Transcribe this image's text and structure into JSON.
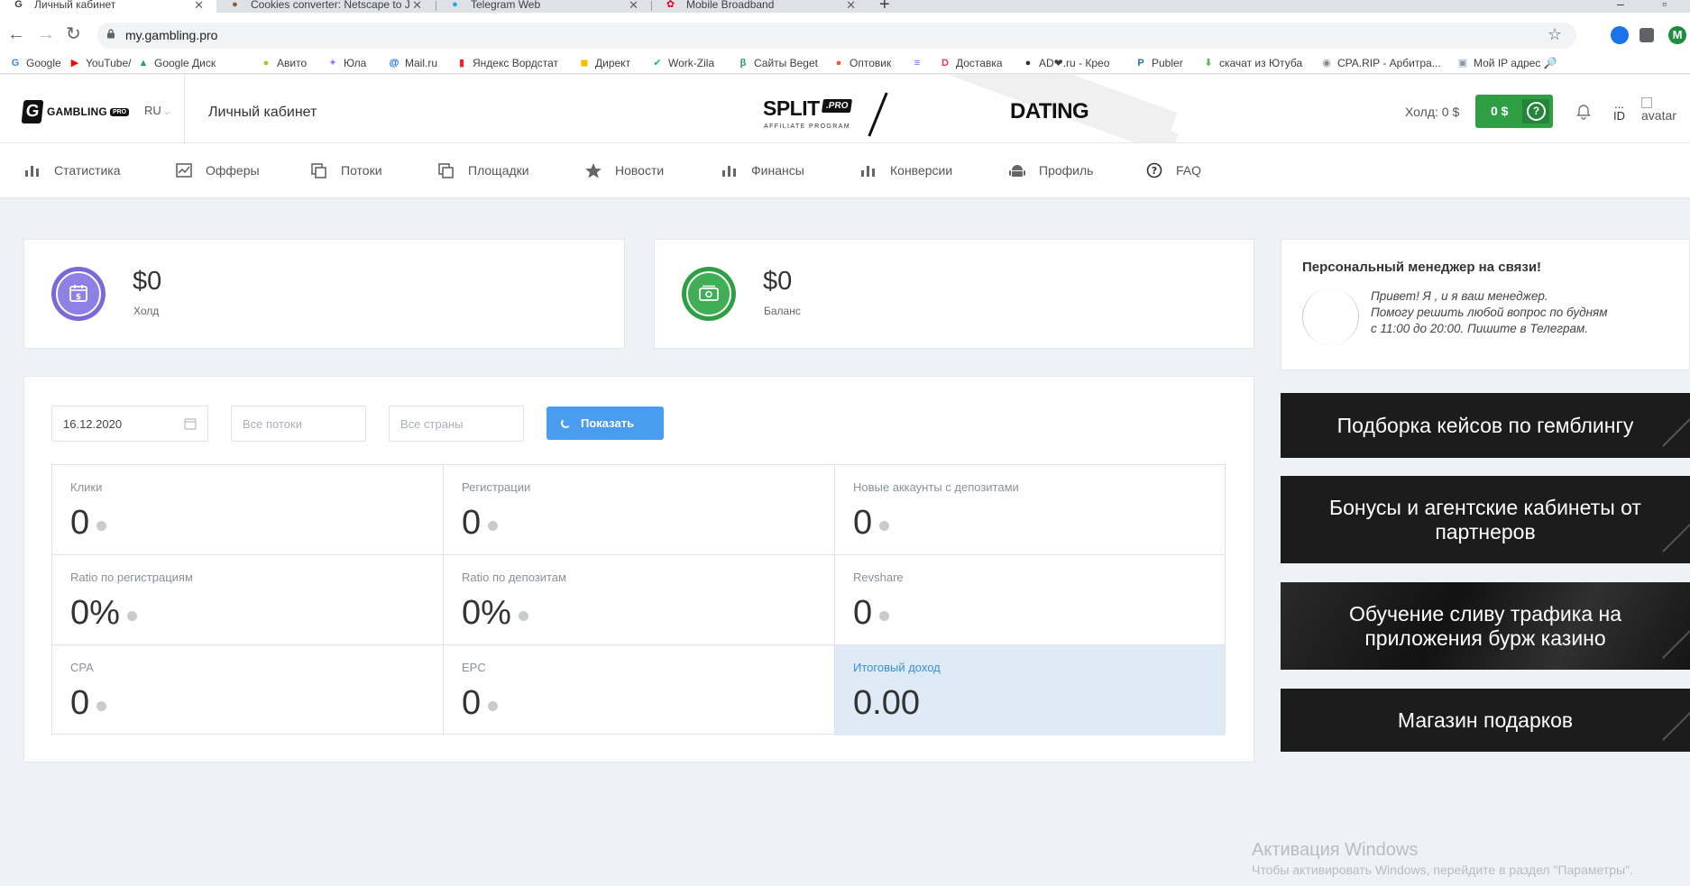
{
  "browser": {
    "tabs": [
      {
        "title": "Личный кабинет",
        "icon": "gambling-favicon-icon"
      },
      {
        "title": "Cookies converter: Netscape to J",
        "icon": "cookie-icon"
      },
      {
        "title": "Telegram Web",
        "icon": "telegram-icon"
      },
      {
        "title": "Mobile Broadband",
        "icon": "huawei-icon"
      }
    ],
    "url": "my.gambling.pro",
    "profile_initial": "M",
    "bookmarks": [
      {
        "label": "Google",
        "icon_char": "G",
        "color": "#4285f4"
      },
      {
        "label": "YouTube/",
        "icon_char": "▶",
        "color": "#ff0000"
      },
      {
        "label": "Google Диск",
        "icon_char": "▲",
        "color": "#1fa463"
      },
      {
        "label": "Авито",
        "icon_char": "●",
        "color": "#97cf26"
      },
      {
        "label": "Юла",
        "icon_char": "✦",
        "color": "#a06bff"
      },
      {
        "label": "Mail.ru",
        "icon_char": "@",
        "color": "#005ff9"
      },
      {
        "label": "Яндекс Вордстат",
        "icon_char": "▮",
        "color": "#e22"
      },
      {
        "label": "Директ",
        "icon_char": "◼",
        "color": "#f2c200"
      },
      {
        "label": "Work-Zila",
        "icon_char": "✔",
        "color": "#1fb57a"
      },
      {
        "label": "Сайты Beget",
        "icon_char": "β",
        "color": "#2a9d5c"
      },
      {
        "label": "Оптовик",
        "icon_char": "●",
        "color": "#f05a28"
      },
      {
        "label": "",
        "icon_char": "≡",
        "color": "#4a6cf7"
      },
      {
        "label": "Доставка",
        "icon_char": "D",
        "color": "#e8335c"
      },
      {
        "label": "AD❤.ru - Крео",
        "icon_char": "●",
        "color": "#333"
      },
      {
        "label": "Publer",
        "icon_char": "P",
        "color": "#2b6cb0"
      },
      {
        "label": "скачат из Ютуба",
        "icon_char": "⬇",
        "color": "#5cb85c"
      },
      {
        "label": "CPA.RIP - Арбитра...",
        "icon_char": "◉",
        "color": "#888"
      },
      {
        "label": "Мой IP адрес 🔎",
        "icon_char": "▣",
        "color": "#8899aa"
      }
    ]
  },
  "header": {
    "lang": "RU",
    "title": "Личный кабинет",
    "split_brand": "SPLIT",
    "split_pro": ".PRO",
    "split_sub": "AFFILIATE PROGRAM",
    "dating": "DATING",
    "hold_label": "Холд: 0 $",
    "balance_value": "0 $",
    "help_char": "?",
    "id_dots": "...",
    "id_label": "ID",
    "avatar_alt": "avatar"
  },
  "nav": [
    {
      "label": "Статистика",
      "icon": "chart-bar-icon"
    },
    {
      "label": "Офферы",
      "icon": "line-chart-icon"
    },
    {
      "label": "Потоки",
      "icon": "copy-icon"
    },
    {
      "label": "Площадки",
      "icon": "copy-icon"
    },
    {
      "label": "Новости",
      "icon": "star-icon"
    },
    {
      "label": "Финансы",
      "icon": "chart-bar-icon"
    },
    {
      "label": "Конверсии",
      "icon": "chart-bar-icon"
    },
    {
      "label": "Профиль",
      "icon": "android-icon"
    },
    {
      "label": "FAQ",
      "icon": "question-circle-icon"
    }
  ],
  "stats": {
    "hold": {
      "value": "$0",
      "label": "Холд",
      "color": "#7a6ad8"
    },
    "balance": {
      "value": "$0",
      "label": "Баланс",
      "color": "#2f9e44"
    }
  },
  "filters": {
    "date": "16.12.2020",
    "streams_placeholder": "Все потоки",
    "countries_placeholder": "Все страны",
    "show_button": "Показать"
  },
  "metrics": [
    {
      "label": "Клики",
      "value": "0",
      "dot": true
    },
    {
      "label": "Регистрации",
      "value": "0",
      "dot": true
    },
    {
      "label": "Новые аккаунты с депозитами",
      "value": "0",
      "dot": true
    },
    {
      "label": "Ratio по регистрациям",
      "value": "0%",
      "dot": true
    },
    {
      "label": "Ratio по депозитам",
      "value": "0%",
      "dot": true
    },
    {
      "label": "Revshare",
      "value": "0",
      "dot": true
    },
    {
      "label": "CPA",
      "value": "0",
      "dot": true
    },
    {
      "label": "EPC",
      "value": "0",
      "dot": true
    },
    {
      "label": "Итоговый доход",
      "value": "0.00",
      "dot": false
    }
  ],
  "manager": {
    "title": "Персональный менеджер на связи!",
    "line1": "Привет! Я , и я ваш менеджер.",
    "line2": "Помогу решить любой вопрос по будням",
    "line3": "с 11:00 до 20:00. Пишите в Телеграм."
  },
  "promos": [
    "Подборка кейсов по гемблингу",
    "Бонусы и агентские кабинеты от партнеров",
    "Обучение сливу трафика на приложения бурж казино",
    "Магазин подарков"
  ],
  "watermark": {
    "title": "Активация Windows",
    "sub": "Чтобы активировать Windows, перейдите в раздел \"Параметры\"."
  }
}
